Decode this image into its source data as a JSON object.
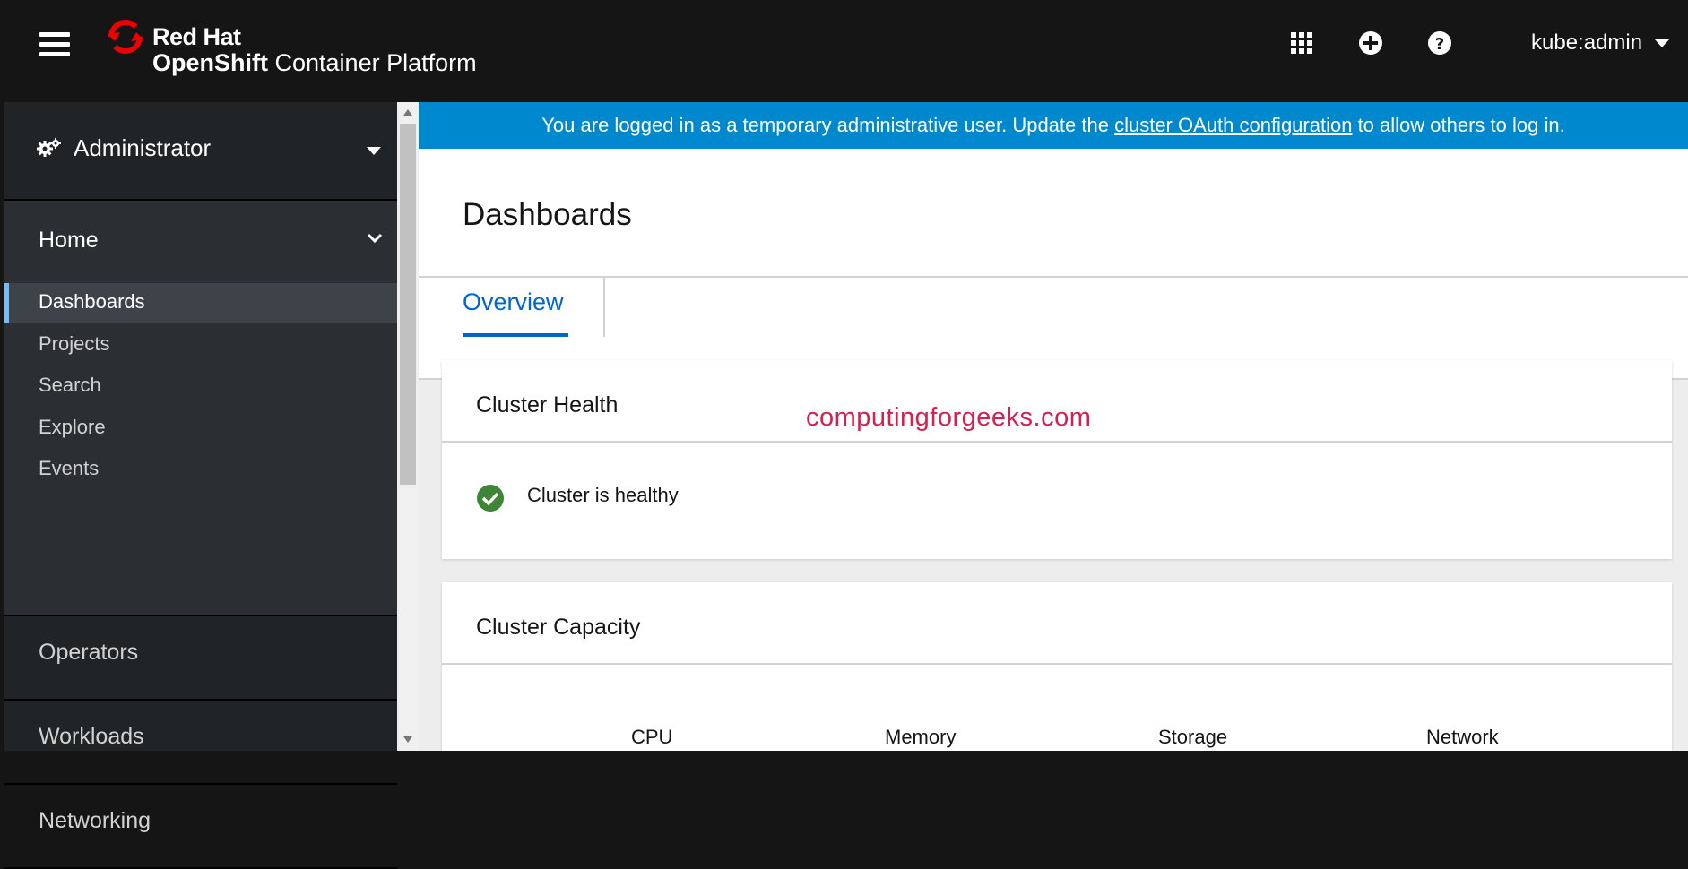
{
  "masthead": {
    "brand_top": "Red Hat",
    "brand_bottom_bold": "OpenShift",
    "brand_bottom_rest": " Container Platform",
    "user": "kube:admin",
    "icons": [
      "hamburger-menu-icon",
      "app-launcher-grid-icon",
      "add-circle-icon",
      "help-circle-icon",
      "caret-down-icon"
    ]
  },
  "sidebar": {
    "perspective": "Administrator",
    "home": {
      "title": "Home",
      "items": [
        "Dashboards",
        "Projects",
        "Search",
        "Explore",
        "Events"
      ],
      "active": "Dashboards"
    },
    "groups": [
      "Operators",
      "Workloads",
      "Networking"
    ]
  },
  "banner": {
    "text_before": "You are logged in as a temporary administrative user. Update the ",
    "link": "cluster OAuth configuration",
    "text_after": " to allow others to log in."
  },
  "page": {
    "title": "Dashboards",
    "tabs": [
      "Overview"
    ],
    "active_tab": "Overview"
  },
  "cards": {
    "health": {
      "title": "Cluster Health",
      "status": "Cluster is healthy"
    },
    "capacity": {
      "title": "Cluster Capacity",
      "columns": [
        "CPU",
        "Memory",
        "Storage",
        "Network"
      ]
    }
  },
  "watermark": "computingforgeeks.com",
  "colors": {
    "masthead": "#151515",
    "sidebar": "#212427",
    "banner": "#0088ce",
    "link": "#0066cc",
    "healthy": "#3e8635",
    "watermark": "#d2224f"
  }
}
